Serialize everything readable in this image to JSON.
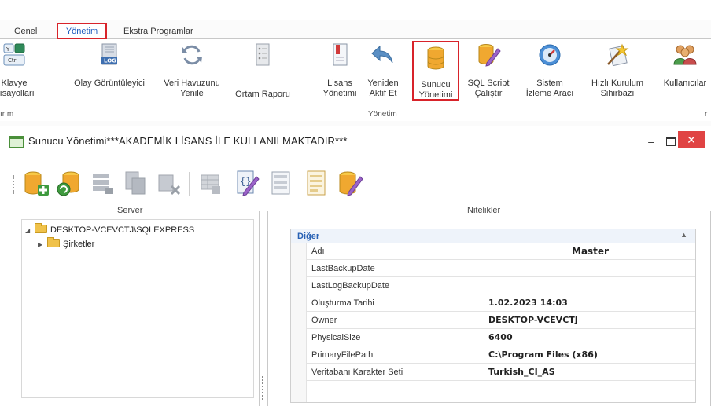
{
  "ribbon": {
    "tabs": [
      {
        "label": "Genel"
      },
      {
        "label": "Yönetim"
      },
      {
        "label": "Ekstra Programlar"
      }
    ],
    "buttons": [
      {
        "label": "Klavye\nKısayolları",
        "icon": "keyboard-icon"
      },
      {
        "label": "Olay Görüntüleyici",
        "icon": "log-icon"
      },
      {
        "label": "Veri Havuzunu\nYenile",
        "icon": "refresh-icon"
      },
      {
        "label": "Ortam Raporu",
        "icon": "report-icon"
      },
      {
        "label": "Lisans\nYönetimi",
        "icon": "license-icon"
      },
      {
        "label": "Yeniden\nAktif Et",
        "icon": "reactivate-icon"
      },
      {
        "label": "Sunucu\nYönetimi",
        "icon": "database-icon"
      },
      {
        "label": "SQL Script\nÇalıştır",
        "icon": "sql-script-icon"
      },
      {
        "label": "Sistem\nİzleme Aracı",
        "icon": "gauge-icon"
      },
      {
        "label": "Hızlı Kurulum\nSihirbazı",
        "icon": "wizard-icon"
      },
      {
        "label": "Kullanıcılar",
        "icon": "users-icon"
      }
    ],
    "groups": [
      {
        "label": "ırım"
      },
      {
        "label": "Yönetim"
      },
      {
        "label": "r"
      }
    ]
  },
  "window": {
    "title": "Sunucu Yönetimi***AKADEMİK LİSANS İLE KULLANILMAKTADIR***",
    "min_glyph": "–",
    "close_glyph": "✕"
  },
  "toolbar": {
    "icons": [
      "add-database-icon",
      "connect-database-icon",
      "server-list-icon",
      "database-copy-icon",
      "delete-database-icon",
      "table-icon",
      "script-edit-icon",
      "list-icon",
      "document-icon",
      "sql-script-icon"
    ]
  },
  "server_panel": {
    "title": "Server",
    "tree": [
      {
        "label": "DESKTOP-VCEVCTJ\\SQLEXPRESS",
        "arrow": "◢"
      },
      {
        "label": "Şirketler",
        "arrow": "▶"
      }
    ]
  },
  "properties_panel": {
    "title": "Nitelikler",
    "category": "Diğer",
    "category_chevron": "▲",
    "rows": [
      {
        "name": "Adı",
        "value": "Master"
      },
      {
        "name": "LastBackupDate",
        "value": ""
      },
      {
        "name": "LastLogBackupDate",
        "value": ""
      },
      {
        "name": "Oluşturma Tarihi",
        "value": "1.02.2023 14:03"
      },
      {
        "name": "Owner",
        "value": "DESKTOP-VCEVCTJ"
      },
      {
        "name": "PhysicalSize",
        "value": "6400"
      },
      {
        "name": "PrimaryFilePath",
        "value": "C:\\Program Files (x86)"
      },
      {
        "name": "Veritabanı Karakter Seti",
        "value": "Turkish_CI_AS"
      }
    ]
  },
  "colors": {
    "highlight": "#d8232a",
    "accent_blue": "#2861b4",
    "close_button": "#e04343"
  }
}
